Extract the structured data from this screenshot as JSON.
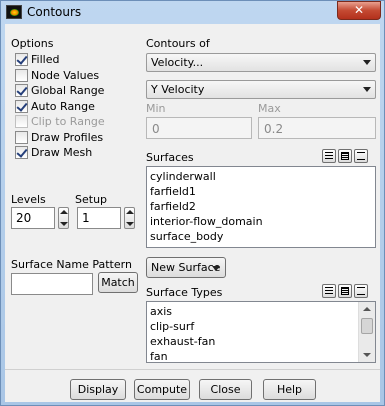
{
  "window": {
    "title": "Contours",
    "close_glyph": "✕"
  },
  "options": {
    "heading": "Options",
    "items": [
      {
        "label": "Filled",
        "checked": true,
        "enabled": true
      },
      {
        "label": "Node Values",
        "checked": false,
        "enabled": true
      },
      {
        "label": "Global Range",
        "checked": true,
        "enabled": true
      },
      {
        "label": "Auto Range",
        "checked": true,
        "enabled": true
      },
      {
        "label": "Clip to Range",
        "checked": false,
        "enabled": false
      },
      {
        "label": "Draw Profiles",
        "checked": false,
        "enabled": true
      },
      {
        "label": "Draw Mesh",
        "checked": true,
        "enabled": true
      }
    ]
  },
  "contours_of": {
    "heading": "Contours of",
    "category": "Velocity...",
    "variable": "Y Velocity"
  },
  "range": {
    "min_label": "Min",
    "min_value": "0",
    "max_label": "Max",
    "max_value": "0.2"
  },
  "levels": {
    "label": "Levels",
    "value": "20"
  },
  "setup": {
    "label": "Setup",
    "value": "1"
  },
  "surfaces": {
    "heading": "Surfaces",
    "items": [
      "cylinderwall",
      "farfield1",
      "farfield2",
      "interior-flow_domain",
      "surface_body"
    ]
  },
  "surface_name_pattern": {
    "label": "Surface Name Pattern",
    "value": "",
    "match_label": "Match"
  },
  "new_surface": {
    "label": "New Surface"
  },
  "surface_types": {
    "heading": "Surface Types",
    "items": [
      "axis",
      "clip-surf",
      "exhaust-fan",
      "fan"
    ]
  },
  "footer": {
    "display": "Display",
    "compute": "Compute",
    "close": "Close",
    "help": "Help"
  }
}
